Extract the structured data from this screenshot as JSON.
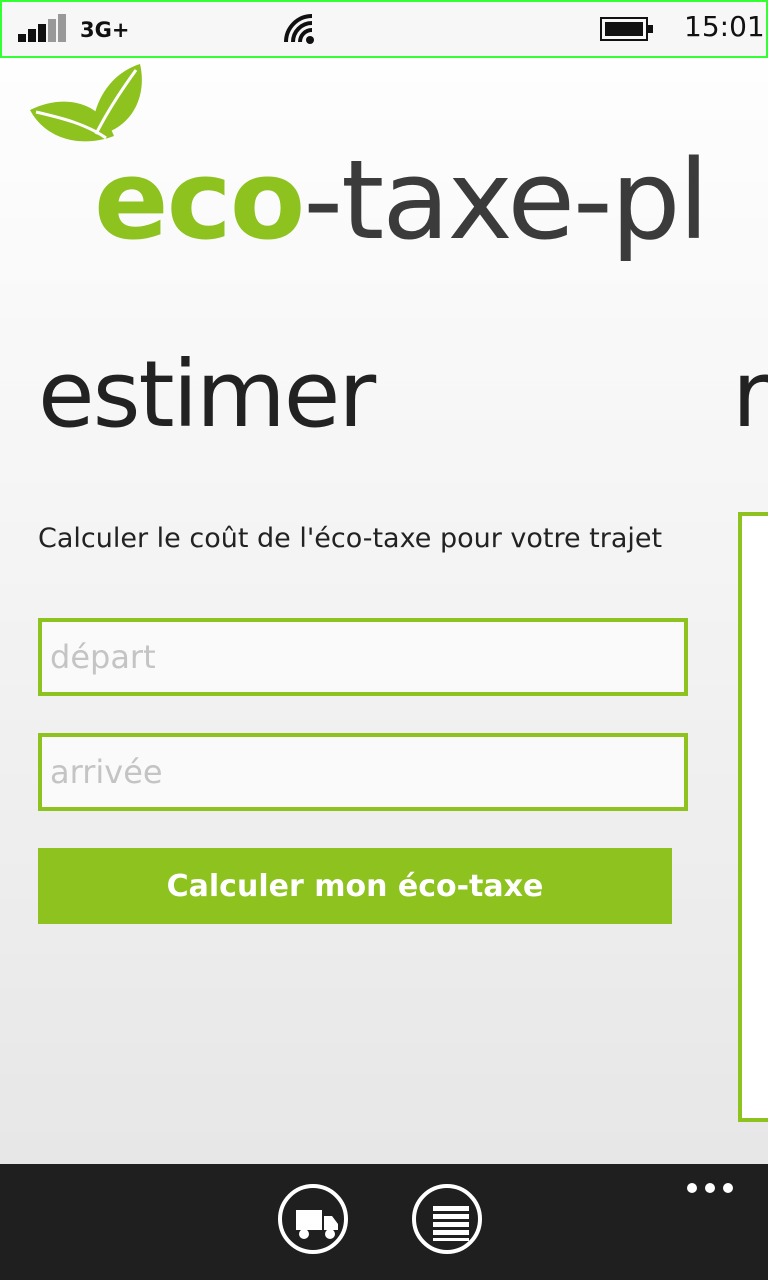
{
  "status": {
    "network": "3G+",
    "time": "15:01",
    "icons": [
      "signal-icon",
      "wifi-icon",
      "battery-icon"
    ]
  },
  "logo": {
    "eco": "eco",
    "rest": "-taxe-pl",
    "icon": "leaf-icon"
  },
  "pivot": {
    "current": "estimer",
    "next_partial": "r"
  },
  "form": {
    "description": "Calculer le coût de l'éco-taxe pour votre trajet",
    "depart_placeholder": "départ",
    "arrivee_placeholder": "arrivée",
    "submit_label": "Calculer mon éco-taxe"
  },
  "appbar": {
    "buttons": [
      "truck-icon",
      "list-icon"
    ],
    "more": "more-icon"
  },
  "colors": {
    "accent": "#8dc21f",
    "appbar": "#1f1f1f",
    "status_border": "#33ff33"
  }
}
